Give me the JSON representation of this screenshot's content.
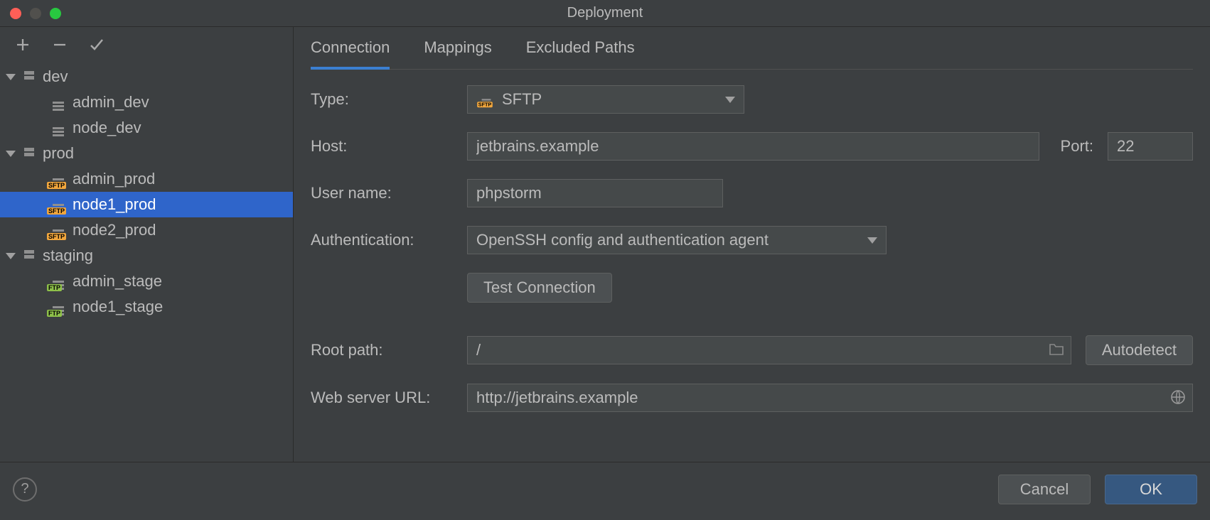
{
  "title": "Deployment",
  "toolbar": {
    "add_tip": "Add",
    "remove_tip": "Remove",
    "apply_tip": "Apply"
  },
  "tree": [
    {
      "type": "group",
      "name": "dev"
    },
    {
      "type": "cfg",
      "name": "admin_dev",
      "kind": "none"
    },
    {
      "type": "cfg",
      "name": "node_dev",
      "kind": "none"
    },
    {
      "type": "group",
      "name": "prod"
    },
    {
      "type": "cfg",
      "name": "admin_prod",
      "kind": "sftp"
    },
    {
      "type": "cfg",
      "name": "node1_prod",
      "kind": "sftp",
      "selected": true
    },
    {
      "type": "cfg",
      "name": "node2_prod",
      "kind": "sftp"
    },
    {
      "type": "group",
      "name": "staging"
    },
    {
      "type": "cfg",
      "name": "admin_stage",
      "kind": "ftp"
    },
    {
      "type": "cfg",
      "name": "node1_stage",
      "kind": "ftp"
    }
  ],
  "tabs": {
    "connection": "Connection",
    "mappings": "Mappings",
    "excluded": "Excluded Paths",
    "active": "connection"
  },
  "form": {
    "type_label": "Type:",
    "type_value": "SFTP",
    "host_label": "Host:",
    "host_value": "jetbrains.example",
    "port_label": "Port:",
    "port_value": "22",
    "user_label": "User name:",
    "user_value": "phpstorm",
    "auth_label": "Authentication:",
    "auth_value": "OpenSSH config and authentication agent",
    "test_btn": "Test Connection",
    "root_label": "Root path:",
    "root_value": "/",
    "autodetect_btn": "Autodetect",
    "url_label": "Web server URL:",
    "url_value": "http://jetbrains.example"
  },
  "footer": {
    "cancel": "Cancel",
    "ok": "OK"
  }
}
